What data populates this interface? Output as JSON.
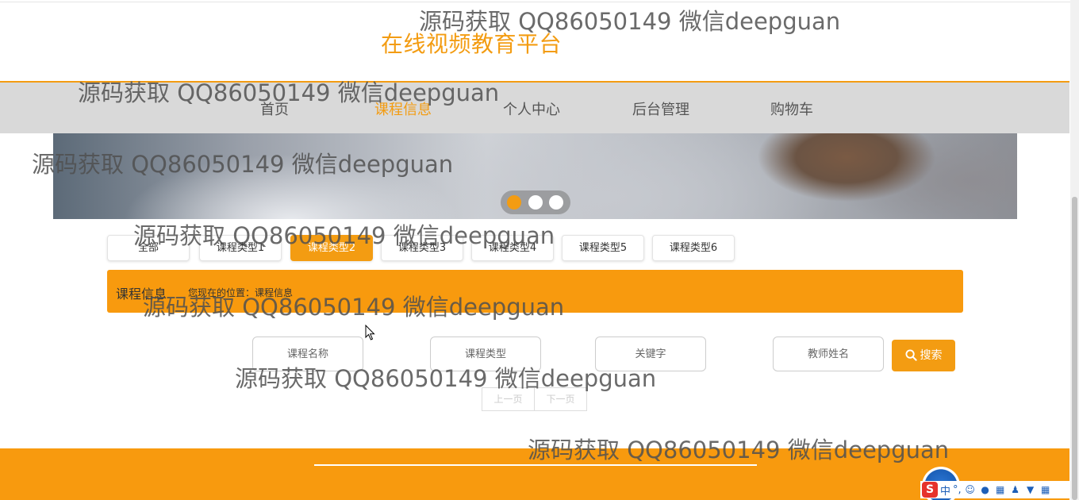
{
  "site": {
    "title": "在线视频教育平台"
  },
  "nav": {
    "items": [
      {
        "label": "首页"
      },
      {
        "label": "课程信息",
        "active": true
      },
      {
        "label": "个人中心"
      },
      {
        "label": "后台管理"
      },
      {
        "label": "购物车"
      }
    ]
  },
  "banner": {
    "slide_count": 3,
    "active_slide": 1
  },
  "categories": [
    {
      "label": "全部"
    },
    {
      "label": "课程类型1"
    },
    {
      "label": "课程类型2",
      "active": true
    },
    {
      "label": "课程类型3"
    },
    {
      "label": "课程类型4"
    },
    {
      "label": "课程类型5"
    },
    {
      "label": "课程类型6"
    }
  ],
  "info_bar": {
    "title": "课程信息",
    "location": "您现在的位置：课程信息"
  },
  "search": {
    "course_name_placeholder": "课程名称",
    "course_type_placeholder": "课程类型",
    "keyword_placeholder": "关键字",
    "teacher_placeholder": "教师姓名",
    "button_label": "搜索"
  },
  "pager": {
    "prev_label": "上一页",
    "next_label": "下一页"
  },
  "watermark": {
    "text": "源码获取 QQ86050149 微信deepguan"
  },
  "ime": {
    "mode_label": "中",
    "punct_label": "°,"
  },
  "colors": {
    "accent": "#f39c12",
    "nav_bg": "#d9d9d9",
    "footer_bg": "#f89a0e"
  }
}
